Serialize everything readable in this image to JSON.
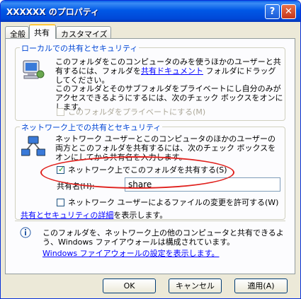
{
  "window": {
    "title": "XXXXXX のプロパティ",
    "help_glyph": "?",
    "close_glyph": "✕"
  },
  "tabs": [
    {
      "label": "全般"
    },
    {
      "label": "共有"
    },
    {
      "label": "カスタマイズ"
    }
  ],
  "local": {
    "title": "ローカルでの共有とセキュリティ",
    "desc1_pre": "このフォルダをこのコンピュータのみを使うほかのユーザーと共有するには、フォルダを",
    "desc1_link": "共有ドキュメント",
    "desc1_post": " フォルダにドラッグしてください。",
    "desc2": "このフォルダとそのサブフォルダをプライベートにし自分のみがアクセスできるようにするには、次のチェック ボックスをオンにします。",
    "private_label": "このフォルダをプライベートにする(M)"
  },
  "network": {
    "title": "ネットワーク上での共有とセキュリティ",
    "desc": "ネットワーク ユーザーとこのコンピュータのほかのユーザーの両方とこのフォルダを共有するには、次のチェック ボックスをオンにしてから共有名を入力します。",
    "share_checkbox_label": "ネットワーク上でこのフォルダを共有する(S)",
    "share_checked": true,
    "share_name_label": "共有名(H):",
    "share_name_value": "share",
    "allow_change_label": "ネットワーク ユーザーによるファイルの変更を許可する(W)",
    "allow_change_checked": false,
    "details_link": "共有とセキュリティの詳細",
    "details_post": "を表示します。"
  },
  "info": {
    "text": "このフォルダを、ネットワーク上の他のコンピュータと共有できるよう、Windows ファイアウォールは構成されています。",
    "link": "Windows ファイアウォールの設定を表示します。"
  },
  "buttons": {
    "ok": "OK",
    "cancel": "キャンセル",
    "apply": "適用(A)"
  },
  "colors": {
    "title_bar": "#0058e6",
    "group_title": "#0046d5",
    "link": "#0000ff",
    "highlight_ellipse": "#e0201c"
  },
  "icons": [
    "local-computer-icon",
    "network-share-icon",
    "info-icon"
  ]
}
